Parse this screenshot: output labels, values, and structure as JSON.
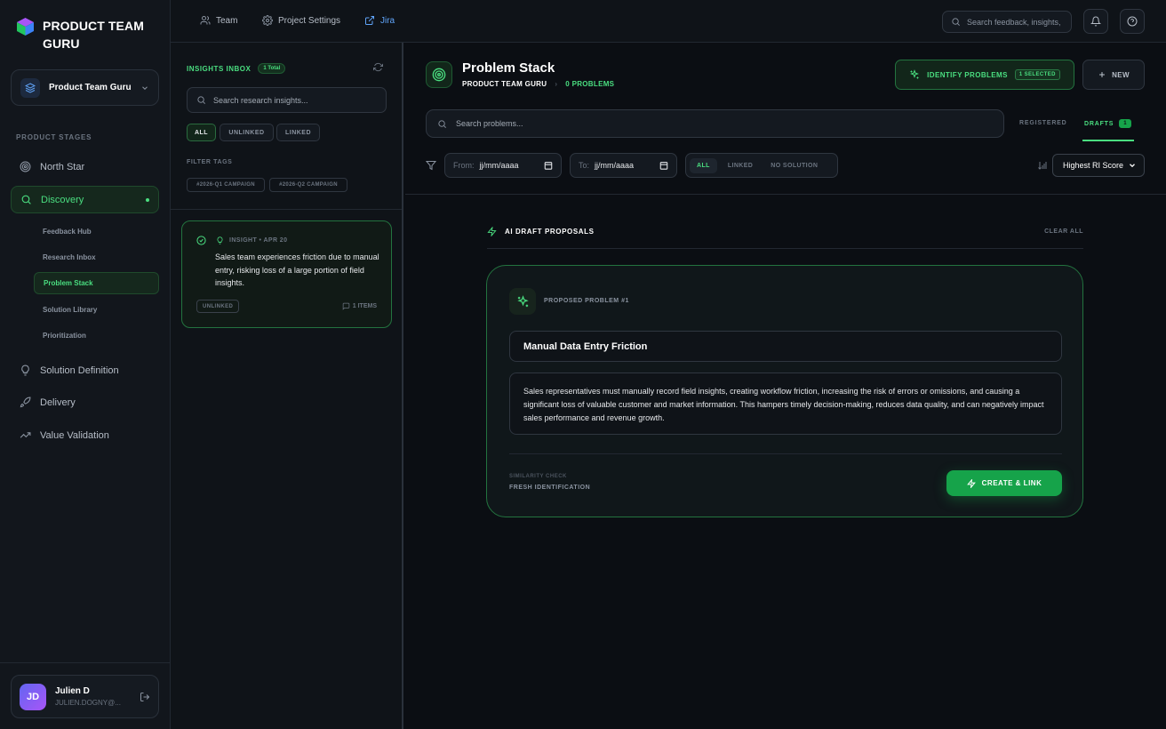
{
  "app": {
    "title": "PRODUCT TEAM GURU",
    "workspace": "Product Team Guru"
  },
  "sidebar": {
    "section_label": "PRODUCT STAGES",
    "items": [
      {
        "label": "North Star",
        "icon": "target-icon"
      },
      {
        "label": "Discovery",
        "icon": "search-icon",
        "active": true
      },
      {
        "label": "Solution Definition",
        "icon": "lightbulb-icon"
      },
      {
        "label": "Delivery",
        "icon": "rocket-icon"
      },
      {
        "label": "Value Validation",
        "icon": "trending-up-icon"
      }
    ],
    "sub_items": [
      {
        "label": "Feedback Hub"
      },
      {
        "label": "Research Inbox"
      },
      {
        "label": "Problem Stack",
        "active": true
      },
      {
        "label": "Solution Library"
      },
      {
        "label": "Prioritization"
      }
    ],
    "user": {
      "initials": "JD",
      "name": "Julien D",
      "email": "JULIEN.DOGNY@..."
    }
  },
  "topbar": {
    "links": [
      {
        "label": "Team",
        "icon": "users-icon"
      },
      {
        "label": "Project Settings",
        "icon": "gear-icon"
      },
      {
        "label": "Jira",
        "icon": "external-link-icon"
      }
    ],
    "search_placeholder": "Search feedback, insights,"
  },
  "inbox": {
    "title": "INSIGHTS INBOX",
    "total_badge": "1 Total",
    "search_placeholder": "Search research insights...",
    "filters": [
      "ALL",
      "UNLINKED",
      "LINKED"
    ],
    "active_filter": "ALL",
    "filter_tags_label": "FILTER TAGS",
    "tags": [
      "#2026-Q1 CAMPAIGN",
      "#2026-Q2 CAMPAIGN"
    ],
    "cards": [
      {
        "meta": "INSIGHT • APR 20",
        "text": "Sales team experiences friction due to manual entry, risking loss of a large portion of field insights.",
        "status": "UNLINKED",
        "items": "1 ITEMS"
      }
    ]
  },
  "main": {
    "title": "Problem Stack",
    "crumb_project": "PRODUCT TEAM GURU",
    "crumb_sep": "›",
    "crumb_count": "0 PROBLEMS",
    "identify_label": "IDENTIFY PROBLEMS",
    "selected_badge": "1 SELECTED",
    "new_label": "NEW",
    "search_placeholder": "Search problems...",
    "tabs": {
      "registered": "REGISTERED",
      "drafts": "DRAFTS",
      "drafts_count": "1"
    },
    "from_label": "From:",
    "to_label": "To:",
    "date_placeholder": "jj/mm/aaaa",
    "link_filters": [
      "ALL",
      "LINKED",
      "NO SOLUTION"
    ],
    "active_link_filter": "ALL",
    "sort": "Highest RI Score",
    "ai_section": {
      "title": "AI DRAFT PROPOSALS",
      "clear": "CLEAR ALL"
    },
    "proposal": {
      "label": "PROPOSED PROBLEM #1",
      "title": "Manual Data Entry Friction",
      "description": "Sales representatives must manually record field insights, creating workflow friction, increasing the risk of errors or omissions, and causing a significant loss of valuable customer and market information. This hampers timely decision-making, reduces data quality, and can negatively impact sales performance and revenue growth.",
      "similarity_label": "SIMILARITY CHECK",
      "similarity_value": "FRESH IDENTIFICATION",
      "action": "CREATE & LINK"
    }
  },
  "colors": {
    "accent": "#4ade80",
    "accent_button": "#16a34a",
    "background": "#0b0e13",
    "panel": "#12161c",
    "link": "#60a5fa"
  }
}
